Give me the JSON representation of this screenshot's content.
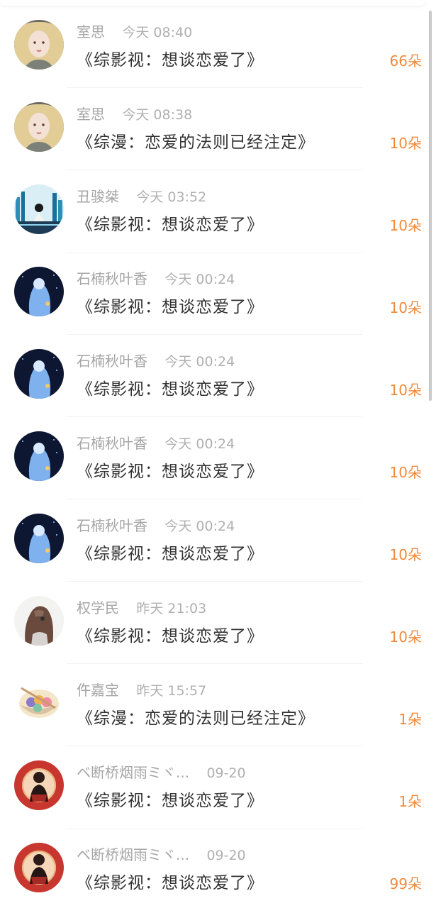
{
  "records": [
    {
      "user": "室思",
      "time": "今天 08:40",
      "book": "《综影视：想谈恋爱了》",
      "gift": "66朵",
      "avatar": "girl-portrait-avatar"
    },
    {
      "user": "室思",
      "time": "今天 08:38",
      "book": "《综漫：恋爱的法则已经注定》",
      "gift": "10朵",
      "avatar": "girl-portrait-avatar"
    },
    {
      "user": "丑骏桀",
      "time": "今天 03:52",
      "book": "《综影视：想谈恋爱了》",
      "gift": "10朵",
      "avatar": "blue-city-avatar"
    },
    {
      "user": "石楠秋叶香",
      "time": "今天 00:24",
      "book": "《综影视：想谈恋爱了》",
      "gift": "10朵",
      "avatar": "night-girl-avatar"
    },
    {
      "user": "石楠秋叶香",
      "time": "今天 00:24",
      "book": "《综影视：想谈恋爱了》",
      "gift": "10朵",
      "avatar": "night-girl-avatar"
    },
    {
      "user": "石楠秋叶香",
      "time": "今天 00:24",
      "book": "《综影视：想谈恋爱了》",
      "gift": "10朵",
      "avatar": "night-girl-avatar"
    },
    {
      "user": "石楠秋叶香",
      "time": "今天 00:24",
      "book": "《综影视：想谈恋爱了》",
      "gift": "10朵",
      "avatar": "night-girl-avatar"
    },
    {
      "user": "权学民",
      "time": "昨天 21:03",
      "book": "《综影视：想谈恋爱了》",
      "gift": "10朵",
      "avatar": "girl-back-avatar"
    },
    {
      "user": "仵嘉宝",
      "time": "昨天 15:57",
      "book": "《综漫：恋爱的法则已经注定》",
      "gift": "1朵",
      "avatar": "food-bowl-avatar"
    },
    {
      "user": "ベ断桥烟雨ミヾ...",
      "time": "09-20",
      "book": "《综影视：想谈恋爱了》",
      "gift": "1朵",
      "avatar": "red-warrior-avatar"
    },
    {
      "user": "ベ断桥烟雨ミヾ...",
      "time": "09-20",
      "book": "《综影视：想谈恋爱了》",
      "gift": "99朵",
      "avatar": "red-warrior-avatar"
    }
  ],
  "colors": {
    "gift": "#f08a3c",
    "username": "#a6a6a6",
    "title": "#333333",
    "divider": "#f2f2f2"
  }
}
